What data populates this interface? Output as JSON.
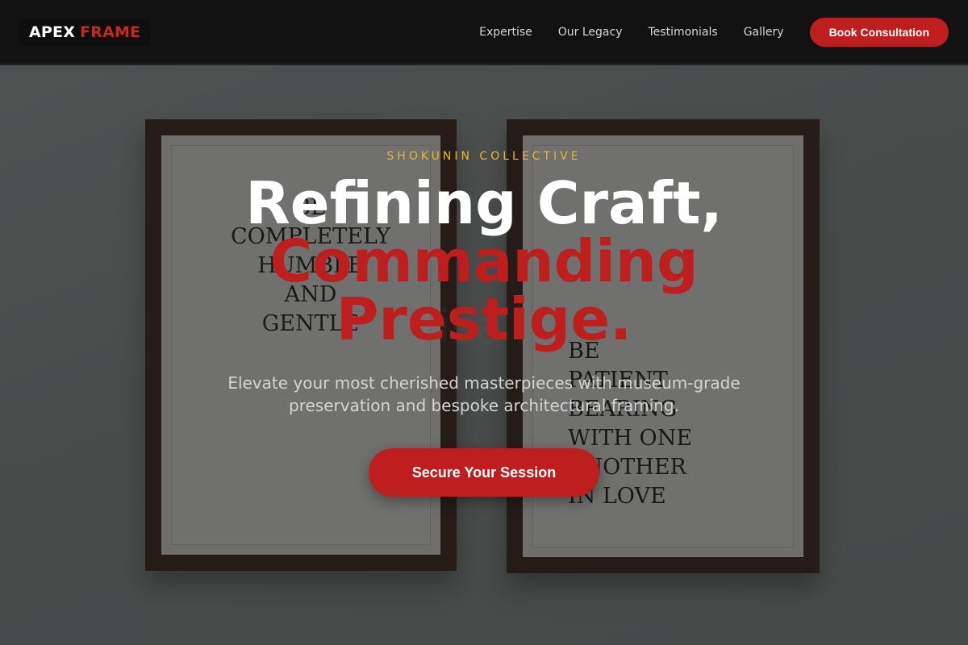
{
  "brand": {
    "word1": "APEX",
    "word2": "FRAME"
  },
  "nav": {
    "links": [
      "Expertise",
      "Our Legacy",
      "Testimonials",
      "Gallery"
    ],
    "cta_label": "Book Consultation"
  },
  "hero": {
    "eyebrow": "SHOKUNIN COLLECTIVE",
    "headline_line1": "Refining Craft,",
    "headline_line2": "Commanding Prestige.",
    "subtitle": "Elevate your most cherished masterpieces with museum-grade preservation and bespoke architectural framing.",
    "cta_label": "Secure Your Session"
  },
  "colors": {
    "accent": "#be1e1e",
    "eyebrow": "#e8b923",
    "nav_bg": "#121212"
  }
}
